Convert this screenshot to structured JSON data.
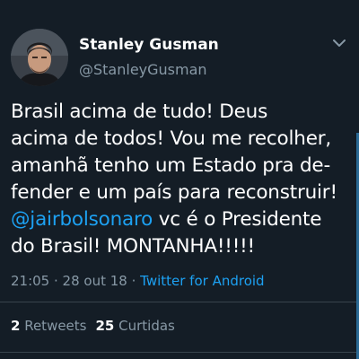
{
  "tweet": {
    "display_name": "Stanley Gusman",
    "handle": "@StanleyGusman",
    "text_line1": "Brasil acima de tudo! Deus",
    "text_line2": "acima de todos! Vou me recolher,",
    "text_line3": "amanhã tenho um Estado pra de-",
    "text_line4": "fender e um país para reconstruir!",
    "mention": "@jairbolsonaro",
    "text_line5_rest": " vc é o Presidente",
    "text_line6": "do Brasil! MONTANHA!!!!!",
    "time": "21:05",
    "date": "28 out 18",
    "separator": " · ",
    "client": "Twitter for Android",
    "retweets_count": "2",
    "retweets_label": " Retweets",
    "likes_count": "25",
    "likes_label": " Curtidas"
  },
  "icons": {
    "caret": "chevron-down-icon",
    "avatar": "profile-photo"
  },
  "colors": {
    "background": "#141d26",
    "text_primary": "#ffffff",
    "text_secondary": "#8899a6",
    "link": "#1da1f2",
    "divider": "#38444d"
  }
}
